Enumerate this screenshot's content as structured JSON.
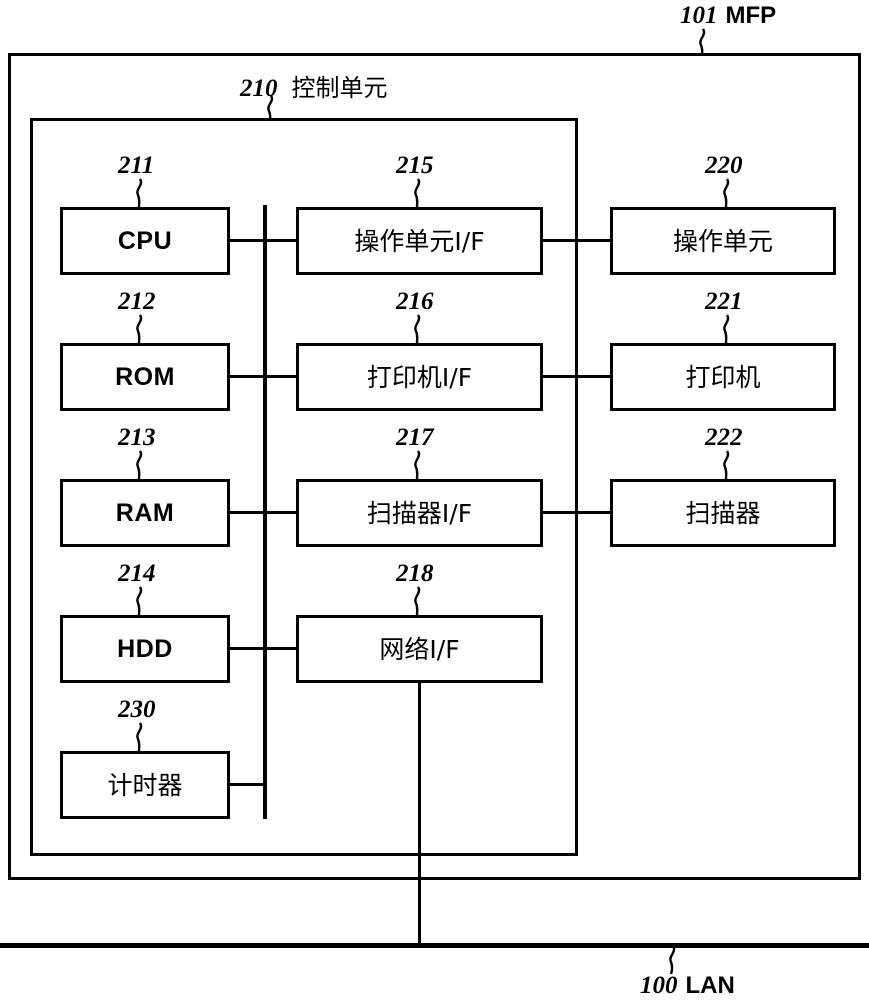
{
  "figure": {
    "type": "patent-block-diagram",
    "device_label": {
      "number": "101",
      "name": "MFP"
    },
    "network_label": {
      "number": "100",
      "name": "LAN"
    },
    "control_unit_label": {
      "number": "210",
      "name": "控制单元"
    }
  },
  "blocks": {
    "cpu": {
      "ref": "211",
      "label": "CPU",
      "script": "latin"
    },
    "rom": {
      "ref": "212",
      "label": "ROM",
      "script": "latin"
    },
    "ram": {
      "ref": "213",
      "label": "RAM",
      "script": "latin"
    },
    "hdd": {
      "ref": "214",
      "label": "HDD",
      "script": "latin"
    },
    "timer": {
      "ref": "230",
      "label": "计时器",
      "script": "cjk"
    },
    "op_unit_if": {
      "ref": "215",
      "label": "操作单元I/F",
      "script": "cjk"
    },
    "printer_if": {
      "ref": "216",
      "label": "打印机I/F",
      "script": "cjk"
    },
    "scanner_if": {
      "ref": "217",
      "label": "扫描器I/F",
      "script": "cjk"
    },
    "network_if": {
      "ref": "218",
      "label": "网络I/F",
      "script": "cjk"
    },
    "op_unit": {
      "ref": "220",
      "label": "操作单元",
      "script": "cjk"
    },
    "printer": {
      "ref": "221",
      "label": "打印机",
      "script": "cjk"
    },
    "scanner": {
      "ref": "222",
      "label": "扫描器",
      "script": "cjk"
    }
  },
  "refs": {
    "r101": "101",
    "r100": "100",
    "r210": "210",
    "r211": "211",
    "r212": "212",
    "r213": "213",
    "r214": "214",
    "r215": "215",
    "r216": "216",
    "r217": "217",
    "r218": "218",
    "r220": "220",
    "r221": "221",
    "r222": "222",
    "r230": "230"
  },
  "names": {
    "mfp": "MFP",
    "lan": "LAN",
    "control_unit": "控制单元"
  },
  "colors": {
    "line": "#000000",
    "background": "#ffffff"
  }
}
